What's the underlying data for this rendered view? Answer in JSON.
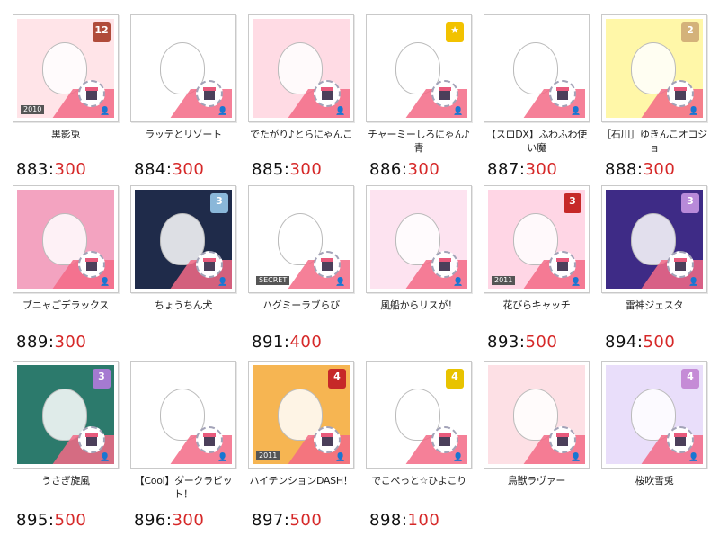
{
  "items": [
    {
      "name": "黒影兎",
      "id": "883",
      "sep": ":",
      "price": "300",
      "bg": "#ffe4e8",
      "badge": "12",
      "badgeColor": "#b04b3a",
      "ribbon": "2010"
    },
    {
      "name": "ラッテとリゾート",
      "id": "884",
      "sep": ":",
      "price": "300",
      "bg": "#ffffff",
      "badge": "",
      "badgeColor": "#ffffff",
      "ribbon": ""
    },
    {
      "name": "でたがり♪とらにゃんこ",
      "id": "885",
      "sep": ":",
      "price": "300",
      "bg": "#ffdbe4",
      "badge": "",
      "badgeColor": "#7ac0e0",
      "ribbon": ""
    },
    {
      "name": "チャーミーしろにゃん♪青",
      "id": "886",
      "sep": ":",
      "price": "300",
      "bg": "#ffffff",
      "badge": "★",
      "badgeColor": "#f2c200",
      "ribbon": ""
    },
    {
      "name": "【スロDX】ふわふわ使い魔",
      "id": "887",
      "sep": ":",
      "price": "300",
      "bg": "#ffffff",
      "badge": "",
      "badgeColor": "#ffffff",
      "ribbon": ""
    },
    {
      "name": "［石川］ゆきんこオコジョ",
      "id": "888",
      "sep": ":",
      "price": "300",
      "bg": "#fff7a8",
      "badge": "2",
      "badgeColor": "#d4b27a",
      "ribbon": ""
    },
    {
      "name": "ブニャごデラックス",
      "id": "889",
      "sep": ":",
      "price": "300",
      "bg": "#f3a3c0",
      "badge": "",
      "badgeColor": "#9cc6e8",
      "ribbon": ""
    },
    {
      "name": "ちょうちん犬",
      "id": "",
      "sep": "",
      "price": "",
      "bg": "#1f2b4a",
      "badge": "3",
      "badgeColor": "#8ab7d9",
      "ribbon": ""
    },
    {
      "name": "ハグミーラブらび",
      "id": "891",
      "sep": ":",
      "price": "400",
      "bg": "#ffffff",
      "badge": "",
      "badgeColor": "#9bd0ef",
      "ribbon": "SECRET"
    },
    {
      "name": "風船からリスが！",
      "id": "",
      "sep": "",
      "price": "",
      "bg": "#fde3f0",
      "badge": "",
      "badgeColor": "#f2a0c8",
      "ribbon": ""
    },
    {
      "name": "花びらキャッチ",
      "id": "893",
      "sep": ":",
      "price": "500",
      "bg": "#ffd6e5",
      "badge": "3",
      "badgeColor": "#c62828",
      "ribbon": "2011"
    },
    {
      "name": "雷神ジェスタ",
      "id": "894",
      "sep": ":",
      "price": "500",
      "bg": "#3e2b86",
      "badge": "3",
      "badgeColor": "#b88ad9",
      "ribbon": ""
    },
    {
      "name": "うさぎ旋風",
      "id": "895",
      "sep": ":",
      "price": "500",
      "bg": "#2c7a6c",
      "badge": "3",
      "badgeColor": "#a57ad1",
      "ribbon": ""
    },
    {
      "name": "【Cool】ダークラビット！",
      "id": "896",
      "sep": ":",
      "price": "300",
      "bg": "#ffffff",
      "badge": "",
      "badgeColor": "#ffffff",
      "ribbon": ""
    },
    {
      "name": "ハイテンションDASH！",
      "id": "897",
      "sep": ":",
      "price": "500",
      "bg": "#f6b552",
      "badge": "4",
      "badgeColor": "#c62828",
      "ribbon": "2011"
    },
    {
      "name": "でこぺっと☆ひよこり",
      "id": "898",
      "sep": ":",
      "price": "100",
      "bg": "#ffffff",
      "badge": "4",
      "badgeColor": "#e8c300",
      "ribbon": ""
    },
    {
      "name": "鳥獣ラヴァー",
      "id": "",
      "sep": "",
      "price": "",
      "bg": "#fde0e5",
      "badge": "",
      "badgeColor": "#e98fb0",
      "ribbon": ""
    },
    {
      "name": "桜吹雪兎",
      "id": "",
      "sep": "",
      "price": "",
      "bg": "#e9defa",
      "badge": "4",
      "badgeColor": "#c58bd6",
      "ribbon": ""
    }
  ]
}
